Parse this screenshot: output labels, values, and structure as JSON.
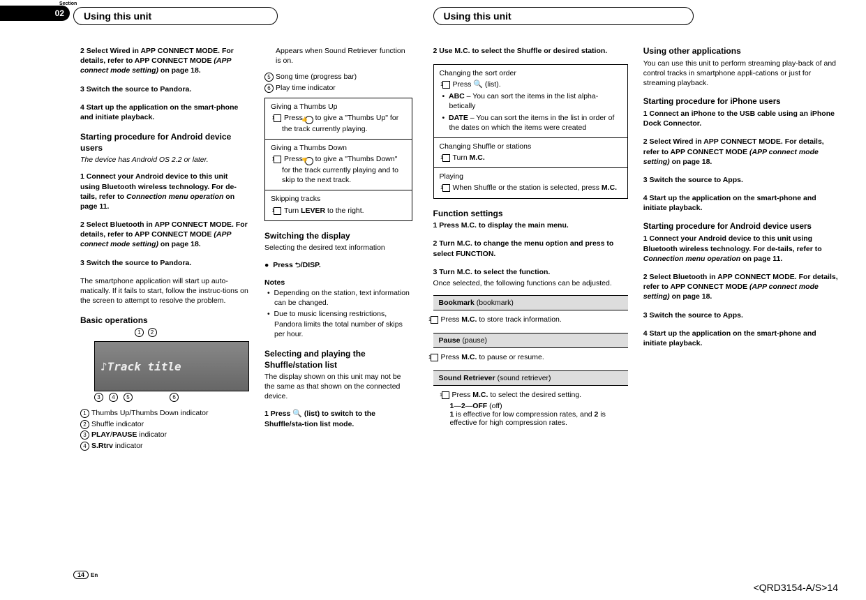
{
  "section_label": "Section",
  "section_num": "02",
  "header_left": "Using this unit",
  "header_right": "Using this unit",
  "page_num": "14",
  "page_lang": "En",
  "footer": "<QRD3154-A/S>14",
  "col1": {
    "s2": "2    Select Wired in APP CONNECT MODE. For details, refer to APP CONNECT MODE ",
    "s2i": "(APP connect mode setting)",
    "s2b": " on page 18.",
    "s3": "3    Switch the source to Pandora.",
    "s4": "4    Start up the application on the smart-phone and initiate playback.",
    "h_android": "Starting procedure for Android device users",
    "android_note": "The device has Android OS 2.2 or later.",
    "a1": "1    Connect your Android device to this unit using Bluetooth wireless technology. For de-tails, refer to ",
    "a1i": "Connection menu operation",
    "a1b": " on page 11.",
    "a2": "2    Select Bluetooth in APP CONNECT MODE. For details, refer to APP CONNECT MODE ",
    "a2i": "(APP connect mode setting)",
    "a2b": " on page 18.",
    "a3": "3    Switch the source to Pandora.",
    "a3desc": "The smartphone application will start up auto-matically. If it fails to start, follow the instruc-tions on the screen to attempt to resolve the problem.",
    "h_basic": "Basic operations",
    "disp_title": "♪Track title",
    "leg1": "Thumbs Up/Thumbs Down indicator",
    "leg2": "Shuffle indicator",
    "leg3a": "PLAY",
    "leg3b": "/",
    "leg3c": "PAUSE",
    "leg3d": " indicator",
    "leg4a": "S.Rtrv",
    "leg4b": " indicator"
  },
  "col2": {
    "l1": "Appears when Sound Retriever function is on.",
    "l5": "Song time (progress bar)",
    "l6": "Play time indicator",
    "box1_h": "Giving a Thumbs Up",
    "box1_t": "Press ",
    "box1_t2": " to give a \"Thumbs Up\" for the track currently playing.",
    "box2_h": "Giving a Thumbs Down",
    "box2_t": "Press ",
    "box2_t2": " to give a \"Thumbs Down\" for the track currently playing and to skip to the next track.",
    "box3_h": "Skipping tracks",
    "box3_t": "Turn ",
    "box3_b": "LEVER",
    "box3_t2": " to the right.",
    "h_switch": "Switching the display",
    "switch_desc": "Selecting the desired text information",
    "press_disp": "Press ",
    "disp_btn": "/DISP",
    "notes": "Notes",
    "n1": "Depending on the station, text information can be changed.",
    "n2": "Due to music licensing restrictions, Pandora limits the total number of skips per hour.",
    "h_shuffle": "Selecting and playing the Shuffle/station list",
    "shuffle_desc": "The display shown on this unit may not be the same as that shown on the connected device.",
    "sh1": "1    Press ",
    "sh1b": " (list) to switch to the Shuffle/sta-tion list mode."
  },
  "col3": {
    "s2": "2    Use M.C. to select the Shuffle or desired station.",
    "box1_h": "Changing the sort order",
    "box1_t": "Press ",
    "box1_t2": " (list).",
    "abc": "ABC",
    "abc_d": " – You can sort the items in the list alpha-betically",
    "date": "DATE",
    "date_d": " – You can sort the items in the list in order of the dates on which the items were created",
    "box2_h": "Changing Shuffle or stations",
    "box2_t": "Turn ",
    "box2_b": "M.C.",
    "box3_h": "Playing",
    "box3_t": "When Shuffle or the station is selected, press ",
    "box3_b": "M.C.",
    "h_func": "Function settings",
    "f1": "1    Press M.C. to display the main menu.",
    "f2": "2    Turn M.C. to change the menu option and press to select FUNCTION.",
    "f3": "3    Turn M.C. to select the function.",
    "f3desc": "Once selected, the following functions can be adjusted.",
    "bk": "Bookmark",
    "bk_p": " (bookmark)",
    "bk_d": "Press ",
    "bk_b": "M.C.",
    "bk_d2": " to store track information.",
    "pa": "Pause",
    "pa_p": " (pause)",
    "pa_d": "Press ",
    "pa_b": "M.C.",
    "pa_d2": " to pause or resume.",
    "sr": "Sound Retriever",
    "sr_p": " (sound retriever)",
    "sr_d": "Press ",
    "sr_b": "M.C.",
    "sr_d2": " to select the desired setting.",
    "sr_opts": "1—2—OFF (off)",
    "sr_desc1": "1",
    "sr_desc2": " is effective for low compression rates, and ",
    "sr_desc3": "2",
    "sr_desc4": " is effective for high compression rates."
  },
  "col4": {
    "h_other": "Using other applications",
    "other_desc": "You can use this unit to perform streaming play-back of and control tracks in smartphone appli-cations or just for streaming playback.",
    "h_iphone": "Starting procedure for iPhone users",
    "i1": "1    Connect an iPhone to the USB cable using an iPhone Dock Connector.",
    "i2": "2    Select Wired in APP CONNECT MODE. For details, refer to APP CONNECT MODE ",
    "i2i": "(APP connect mode setting)",
    "i2b": " on page 18.",
    "i3": "3    Switch the source to Apps.",
    "i4": "4    Start up the application on the smart-phone and initiate playback.",
    "h_android": "Starting procedure for Android device users",
    "a1": "1    Connect your Android device to this unit using Bluetooth wireless technology. For de-tails, refer to ",
    "a1i": "Connection menu operation",
    "a1b": " on page 11.",
    "a2": "2    Select Bluetooth in APP CONNECT MODE. For details, refer to APP CONNECT MODE ",
    "a2i": "(APP connect mode setting)",
    "a2b": " on page 18.",
    "a3": "3    Switch the source to Apps.",
    "a4": "4    Start up the application on the smart-phone and initiate playback."
  }
}
